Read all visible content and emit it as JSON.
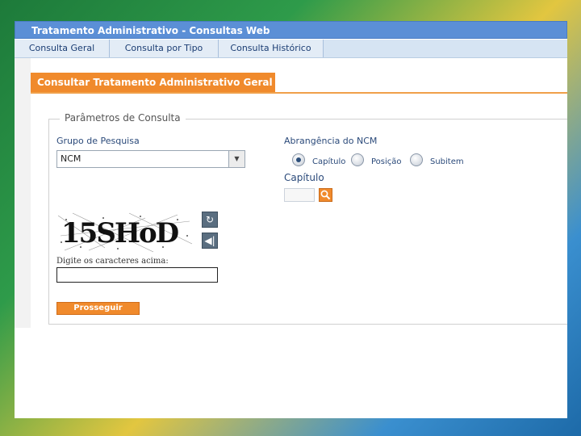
{
  "window": {
    "title": "Tratamento Administrativo - Consultas Web"
  },
  "nav": {
    "tabs": [
      "Consulta Geral",
      "Consulta por Tipo",
      "Consulta Histórico"
    ]
  },
  "section": {
    "title": "Consultar Tratamento Administrativo Geral"
  },
  "form": {
    "legend": "Parâmetros de Consulta",
    "group_label": "Grupo de Pesquisa",
    "group_value": "NCM",
    "scope_label": "Abrangência do NCM",
    "scope_options": [
      "Capítulo",
      "Posição",
      "Subitem"
    ],
    "scope_selected": "Capítulo",
    "chapter_label": "Capítulo",
    "captcha_text": "15SHoD",
    "captcha_instruction": "Digite os caracteres acima:",
    "submit_label": "Prosseguir"
  },
  "colors": {
    "accent": "#f08a2c",
    "titlebar": "#5b8fd6",
    "nav": "#d6e4f3"
  },
  "icons": [
    "refresh-icon",
    "audio-icon",
    "search-icon",
    "chevron-down-icon"
  ]
}
